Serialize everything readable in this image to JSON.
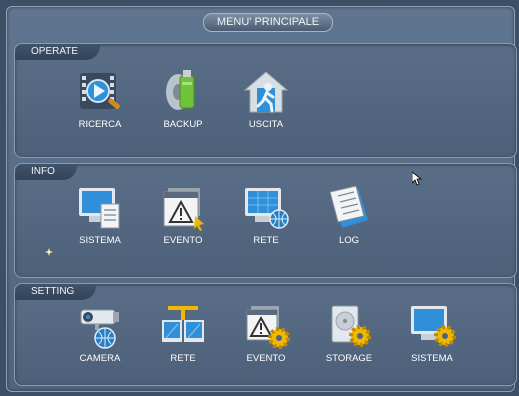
{
  "window": {
    "title": "MENU' PRINCIPALE"
  },
  "sections": [
    {
      "label": "OPERATE",
      "items": [
        {
          "label": "RICERCA",
          "icon": "film-search-icon"
        },
        {
          "label": "BACKUP",
          "icon": "usb-backup-icon"
        },
        {
          "label": "USCITA",
          "icon": "exit-house-icon"
        }
      ]
    },
    {
      "label": "INFO",
      "items": [
        {
          "label": "SISTEMA",
          "icon": "monitor-document-icon"
        },
        {
          "label": "EVENTO",
          "icon": "warning-window-icon"
        },
        {
          "label": "RETE",
          "icon": "monitor-globe-icon"
        },
        {
          "label": "LOG",
          "icon": "log-book-icon"
        }
      ]
    },
    {
      "label": "SETTING",
      "items": [
        {
          "label": "CAMERA",
          "icon": "camera-globe-icon"
        },
        {
          "label": "RETE",
          "icon": "network-monitors-icon"
        },
        {
          "label": "EVENTO",
          "icon": "event-gear-icon"
        },
        {
          "label": "STORAGE",
          "icon": "hdd-gear-icon"
        },
        {
          "label": "SISTEMA",
          "icon": "monitor-gear-icon"
        }
      ]
    }
  ],
  "colors": {
    "background": "#3c4f67",
    "panel": "#5a6e88",
    "text": "#ffffff",
    "gear": "#f0b800",
    "glass": "#2f8fd8"
  }
}
